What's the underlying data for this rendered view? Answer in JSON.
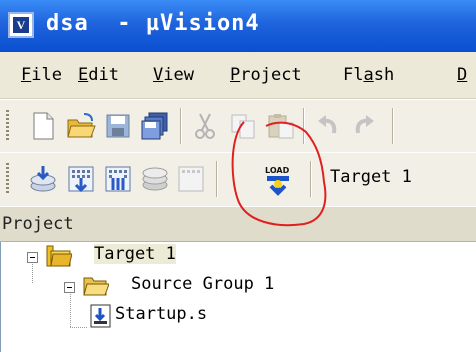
{
  "window": {
    "title": "dsa  - µVision4"
  },
  "menu": {
    "items": [
      {
        "u": "F",
        "rest": "ile"
      },
      {
        "u": "E",
        "rest": "dit"
      },
      {
        "u": "V",
        "rest": "iew"
      },
      {
        "u": "P",
        "rest": "roject"
      },
      {
        "pre": "Fl",
        "u": "a",
        "rest": "sh"
      },
      {
        "u": "D",
        "rest": ""
      }
    ]
  },
  "toolbar1": {
    "icons": [
      "new-file-icon",
      "open-folder-icon",
      "save-icon",
      "save-all-icon",
      "cut-icon",
      "copy-icon",
      "paste-icon",
      "undo-icon",
      "redo-icon"
    ]
  },
  "toolbar2": {
    "icons": [
      "translate-icon",
      "build-icon",
      "rebuild-icon",
      "batch-build-icon",
      "stop-build-icon",
      "load-icon"
    ],
    "load_label": "LOAD",
    "target": "Target 1"
  },
  "project_panel": {
    "title": "Project",
    "tree": [
      {
        "label": "Target 1",
        "level": 0
      },
      {
        "label": "Source Group 1",
        "level": 1
      },
      {
        "label": "Startup.s",
        "level": 2
      }
    ]
  },
  "colors": {
    "titlebar": "#0a4fd0",
    "annotation": "#e02020"
  }
}
